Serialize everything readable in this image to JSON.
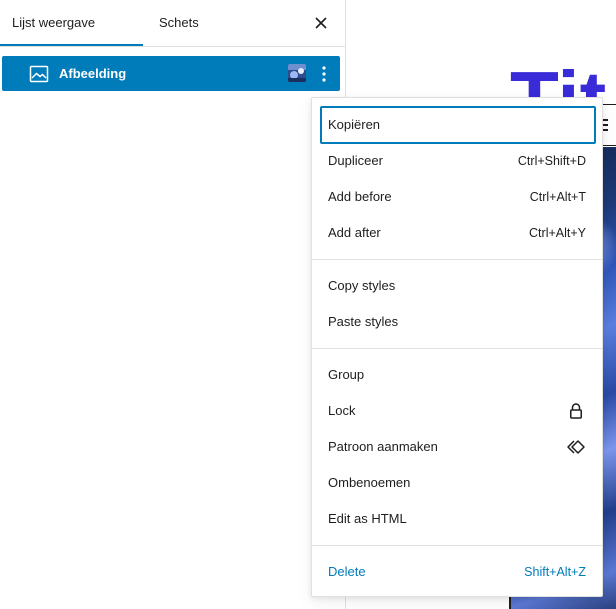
{
  "tabs": {
    "list_view": "Lijst weergave",
    "outline": "Schets"
  },
  "close_icon": "close-icon",
  "block": {
    "icon": "image-icon",
    "label": "Afbeelding",
    "options_icon": "more-vertical-icon"
  },
  "canvas": {
    "title_fragment": "Tit"
  },
  "menu": {
    "items": [
      {
        "label": "Kopiëren",
        "shortcut": "",
        "focused": true
      },
      {
        "label": "Dupliceer",
        "shortcut": "Ctrl+Shift+D"
      },
      {
        "label": "Add before",
        "shortcut": "Ctrl+Alt+T"
      },
      {
        "label": "Add after",
        "shortcut": "Ctrl+Alt+Y"
      },
      {
        "label": "Copy styles",
        "shortcut": ""
      },
      {
        "label": "Paste styles",
        "shortcut": ""
      },
      {
        "label": "Group",
        "shortcut": ""
      },
      {
        "label": "Lock",
        "icon": "lock-icon"
      },
      {
        "label": "Patroon aanmaken",
        "icon": "pattern-icon"
      },
      {
        "label": "Ombenoemen",
        "shortcut": ""
      },
      {
        "label": "Edit as HTML",
        "shortcut": ""
      },
      {
        "label": "Delete",
        "shortcut": "Shift+Alt+Z",
        "danger": true
      }
    ]
  },
  "colors": {
    "accent": "#007cba",
    "title": "#3a2bd8",
    "text": "#1e1e1e",
    "border": "#e0e0e0"
  }
}
